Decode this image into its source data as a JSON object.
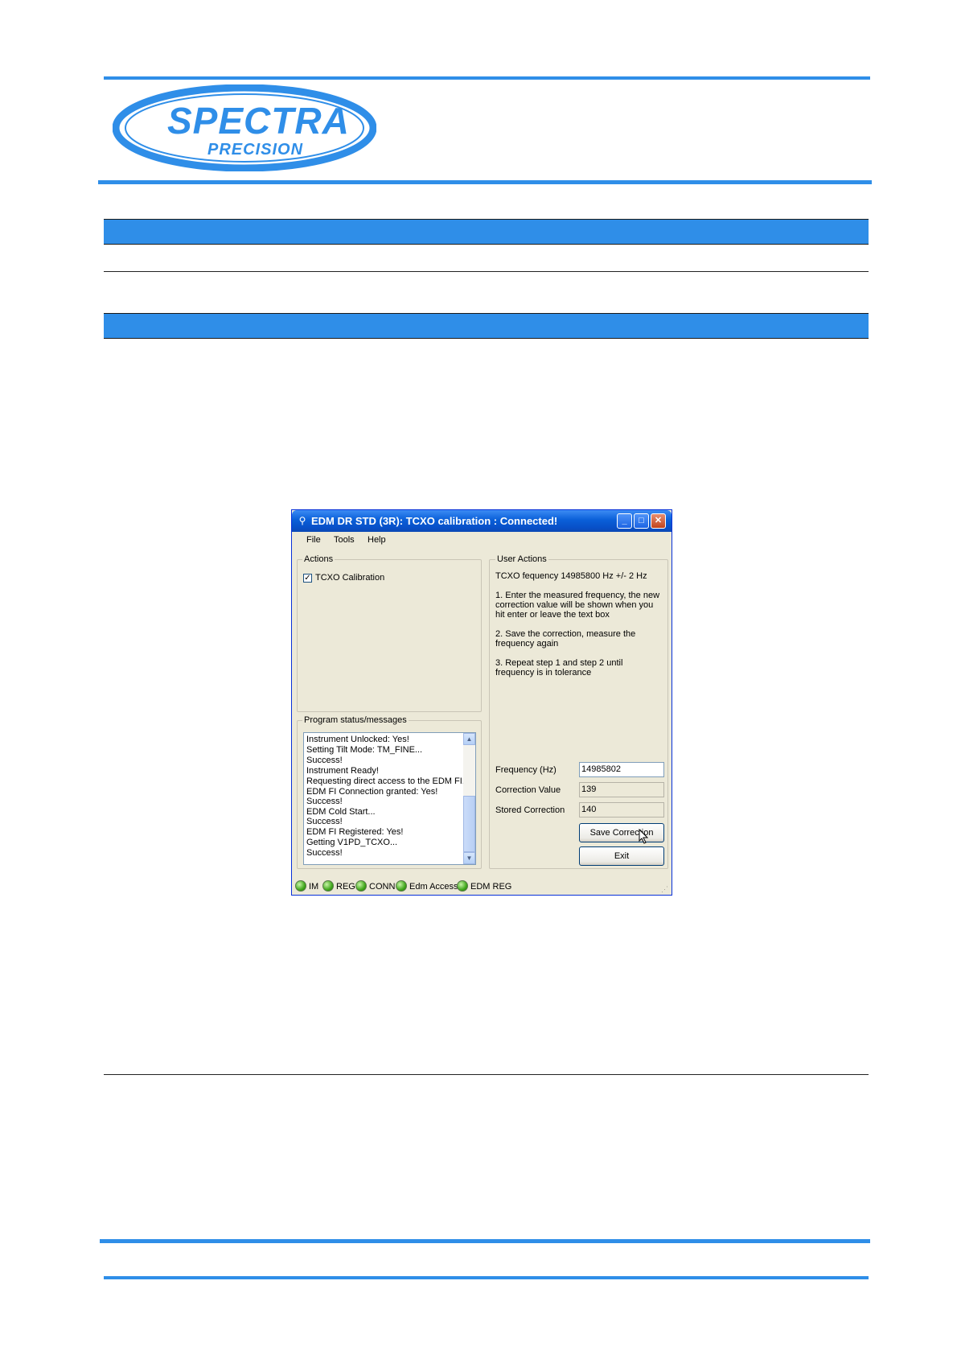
{
  "logo": {
    "line1": "SPECTRA",
    "line2": "PRECISION"
  },
  "window": {
    "title": "EDM DR STD (3R): TCXO calibration : Connected!",
    "menu": [
      "File",
      "Tools",
      "Help"
    ],
    "actions": {
      "label": "Actions",
      "items": [
        {
          "label": "TCXO Calibration",
          "checked": true
        }
      ]
    },
    "program_status": {
      "label": "Program status/messages",
      "messages": [
        "Instrument Unlocked: Yes!",
        "Setting Tilt Mode: TM_FINE...",
        "Success!",
        "Instrument Ready!",
        "Requesting direct access to the EDM FI...",
        "EDM FI Connection granted: Yes!",
        "Success!",
        "EDM Cold Start...",
        "Success!",
        "EDM FI Registered: Yes!",
        "Getting V1PD_TCXO...",
        "Success!"
      ]
    },
    "user_actions": {
      "label": "User Actions",
      "tcxo_line": "TCXO fequency 14985800 Hz +/- 2 Hz",
      "step1": [
        "1.  Enter the measured frequency, the new",
        "correction value will be shown when you",
        "hit enter or leave the text box"
      ],
      "step2": [
        "2.  Save the correction, measure the",
        "frequency again"
      ],
      "step3": [
        "3.  Repeat step 1 and step 2 until",
        "frequency is in tolerance"
      ],
      "frequency_label": "Frequency (Hz)",
      "frequency_value": "14985802",
      "correction_label": "Correction Value",
      "correction_value": "139",
      "stored_label": "Stored Correction",
      "stored_value": "140",
      "save_button": "Save Correction",
      "exit_button": "Exit"
    },
    "status_indicators": [
      "IM",
      "REG",
      "CONN",
      "Edm Access",
      "EDM REG"
    ],
    "status_color": "#41a81c"
  },
  "colors": {
    "accent_blue": "#2f8ee8",
    "title_blue": "#0a5fd8"
  }
}
